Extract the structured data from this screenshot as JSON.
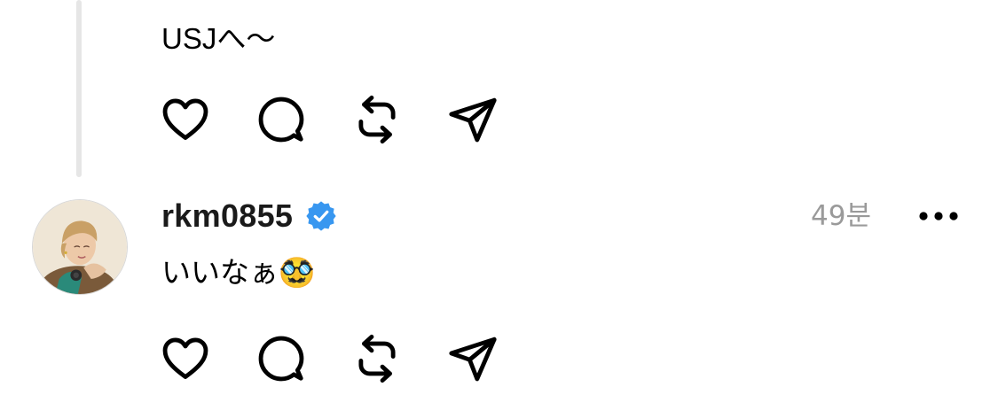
{
  "thread": {
    "parent_post": {
      "text": "USJへ～",
      "actions": [
        "heart-icon",
        "comment-icon",
        "repost-icon",
        "share-icon"
      ]
    },
    "reply": {
      "username": "rkm0855",
      "verified": true,
      "timestamp": "49분",
      "text": "いいなぁ🥸",
      "actions": [
        "heart-icon",
        "comment-icon",
        "repost-icon",
        "share-icon"
      ]
    }
  },
  "colors": {
    "text": "#000000",
    "username": "#1a1a1a",
    "muted": "#9a9a9a",
    "verified_badge": "#3897f0",
    "thread_line": "#e6e6e6"
  }
}
